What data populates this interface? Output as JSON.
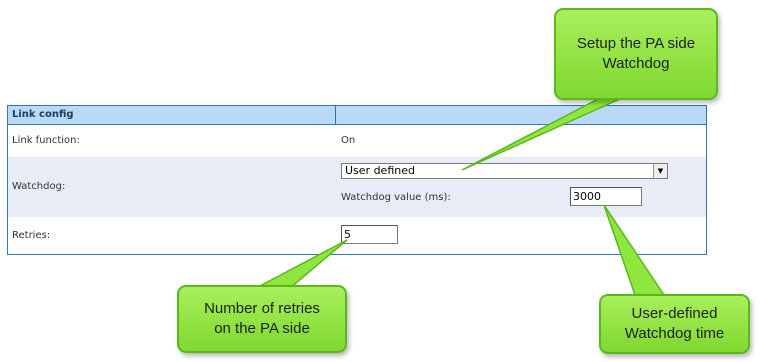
{
  "config_table": {
    "header": "Link config",
    "link_function": {
      "label": "Link function:",
      "value": "On"
    },
    "watchdog": {
      "label": "Watchdog:",
      "mode": "User defined",
      "value_label": "Watchdog value (ms):",
      "value": "3000"
    },
    "retries": {
      "label": "Retries:",
      "value": "5"
    }
  },
  "callouts": {
    "watchdog_setup": [
      "Setup the PA side",
      "Watchdog"
    ],
    "retries": [
      "Number of retries",
      "on the PA side"
    ],
    "watchdog_time": [
      "User-defined",
      "Watchdog time"
    ]
  },
  "colors": {
    "callout_fill": "#8ee63e",
    "header_fill": "#b8daf6",
    "border": "#2f76b8",
    "row_alt": "#e8ecf6"
  }
}
